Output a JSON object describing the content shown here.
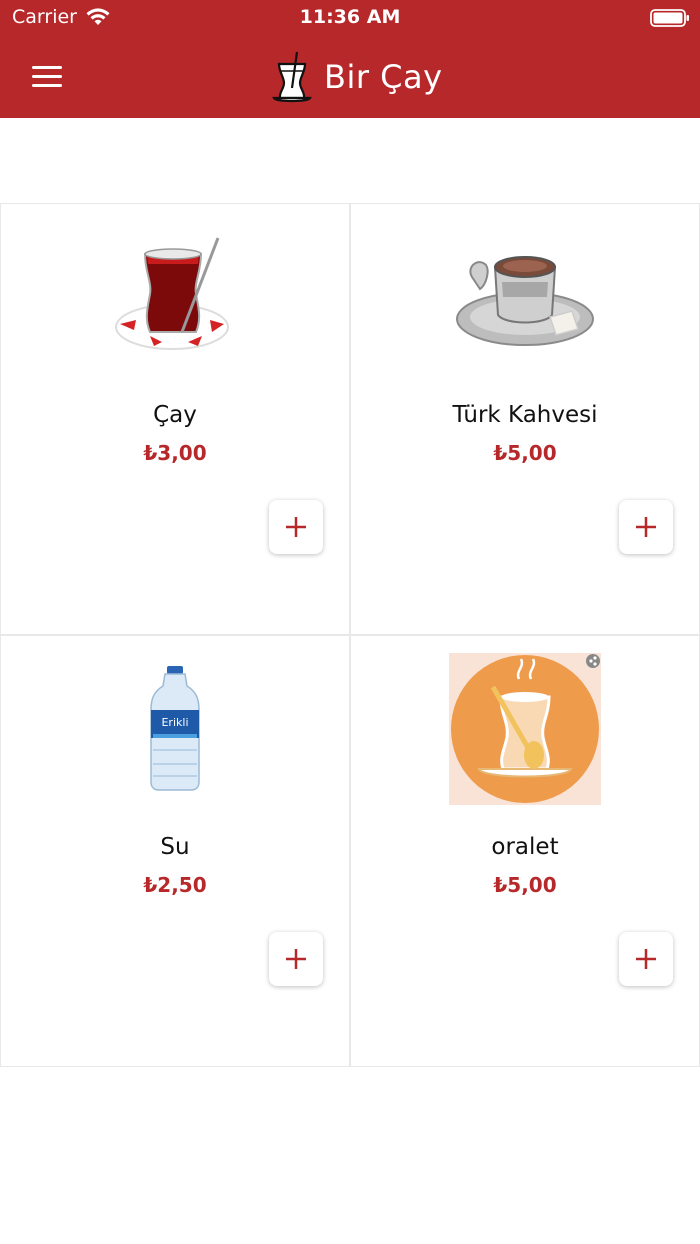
{
  "status_bar": {
    "carrier": "Carrier",
    "time": "11:36 AM"
  },
  "header": {
    "title": "Bir Çay",
    "menu_icon": "hamburger-menu-icon",
    "logo_icon": "tea-glass-icon",
    "background": "#b6282a"
  },
  "products": [
    {
      "name": "Çay",
      "price": "₺3,00",
      "image": "turkish-tea-glass-image"
    },
    {
      "name": "Türk Kahvesi",
      "price": "₺5,00",
      "image": "turkish-coffee-cup-image"
    },
    {
      "name": "Su",
      "price": "₺2,50",
      "image": "water-bottle-image"
    },
    {
      "name": "oralet",
      "price": "₺5,00",
      "image": "oralet-illustration-image"
    }
  ],
  "add_icon": "plus-icon",
  "colors": {
    "accent": "#b6282a",
    "text": "#111111"
  }
}
